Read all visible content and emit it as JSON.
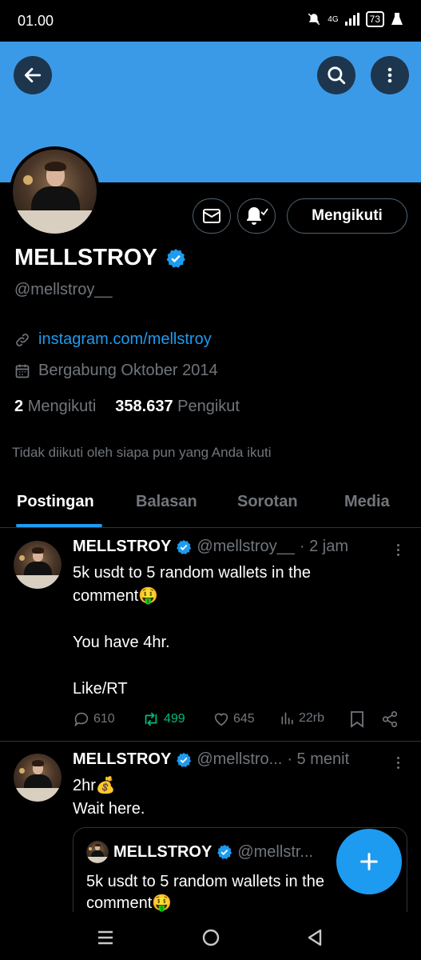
{
  "status_bar": {
    "time": "01.00",
    "network": "4G",
    "battery": "73"
  },
  "icons": {
    "back": "arrow-left-icon",
    "search": "search-icon",
    "more": "more-vertical-icon",
    "mail": "mail-icon",
    "bell": "bell-subscribed-icon",
    "verified": "verified-badge-icon",
    "link": "link-icon",
    "calendar": "calendar-icon",
    "compose": "plus-icon"
  },
  "profile": {
    "name": "MELLSTROY",
    "handle": "@mellstroy__",
    "link": "instagram.com/mellstroy",
    "joined": "Bergabung Oktober 2014",
    "following_count": "2",
    "following_label": "Mengikuti",
    "followers_count": "358.637",
    "followers_label": "Pengikut",
    "followers_note": "Tidak diikuti oleh siapa pun yang Anda ikuti",
    "follow_button": "Mengikuti"
  },
  "tabs": [
    {
      "label": "Postingan",
      "active": true
    },
    {
      "label": "Balasan",
      "active": false
    },
    {
      "label": "Sorotan",
      "active": false
    },
    {
      "label": "Media",
      "active": false
    }
  ],
  "tweets": [
    {
      "name": "MELLSTROY",
      "handle": "@mellstroy__",
      "time": "· 2 jam",
      "text": "5k usdt to 5 random wallets in the\ncomment🤑\n\nYou have 4hr.\n\nLike/RT",
      "replies": "610",
      "retweets": "499",
      "likes": "645",
      "views": "22rb"
    },
    {
      "name": "MELLSTROY",
      "handle": "@mellstro...",
      "time": "· 5 menit",
      "text": "2hr💰\nWait here.",
      "quote": {
        "name": "MELLSTROY",
        "handle": "@mellstr...",
        "text": "5k usdt to 5 random wallets in the\ncomment🤑"
      }
    }
  ],
  "colors": {
    "banner": "#3b9ae8",
    "accent": "#1d9bf0",
    "retweet": "#00ba7c"
  }
}
